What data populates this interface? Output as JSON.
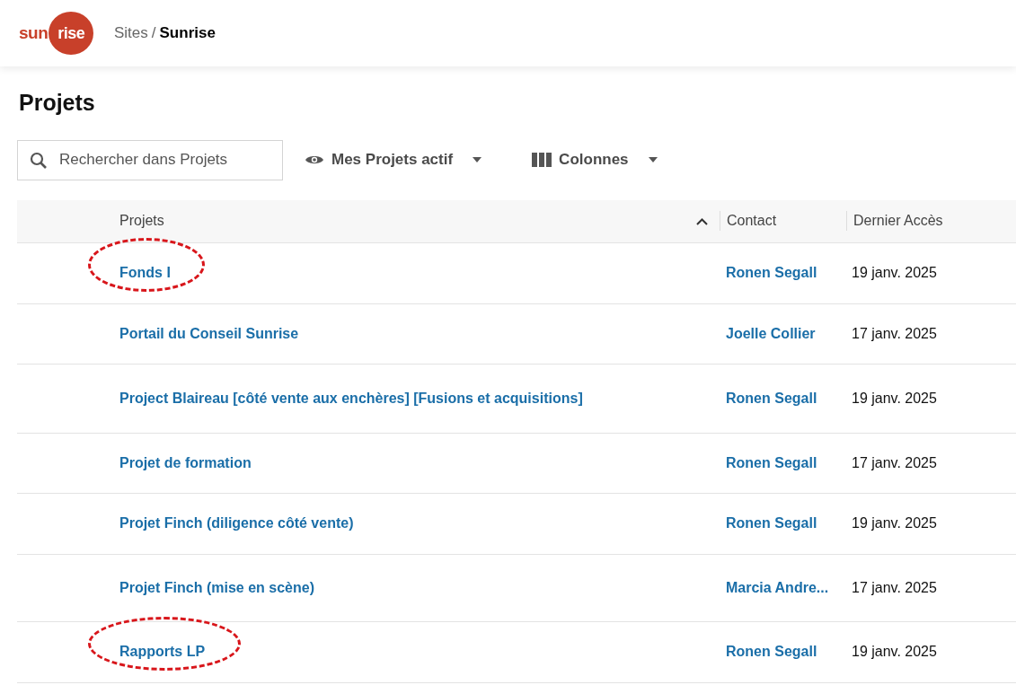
{
  "header": {
    "logo": {
      "part_1": "sun",
      "part_2": "rise"
    },
    "breadcrumb": [
      {
        "label": "Sites",
        "current": false
      },
      {
        "label": "Sunrise",
        "current": true
      }
    ],
    "breadcrumb_separator": "/"
  },
  "page_title": "Projets",
  "toolbar": {
    "search": {
      "placeholder": "Rechercher dans Projets"
    },
    "filter": {
      "label": "Mes Projets actif"
    },
    "columns_menu": {
      "label": "Colonnes"
    }
  },
  "table": {
    "columns": [
      {
        "label": "Projets",
        "sorted": true
      },
      {
        "label": "Contact",
        "sorted": false
      },
      {
        "label": "Dernier Accès",
        "sorted": false
      }
    ],
    "rows": [
      {
        "project": "Fonds I",
        "contact": "Ronen Segall",
        "last_access": "19 janv. 2025",
        "circled": true
      },
      {
        "project": "Portail du Conseil Sunrise",
        "contact": "Joelle Collier",
        "last_access": "17 janv. 2025",
        "circled": false
      },
      {
        "project": "Project Blaireau [côté vente aux enchères] [Fusions et acquisitions]",
        "contact": "Ronen Segall",
        "last_access": "19 janv. 2025",
        "circled": false
      },
      {
        "project": "Projet de formation",
        "contact": "Ronen Segall",
        "last_access": "17 janv. 2025",
        "circled": false
      },
      {
        "project": "Projet Finch (diligence côté vente)",
        "contact": "Ronen Segall",
        "last_access": "19 janv. 2025",
        "circled": false
      },
      {
        "project": "Projet Finch (mise en scène)",
        "contact": "Marcia Andre...",
        "last_access": "17 janv. 2025",
        "circled": false
      },
      {
        "project": "Rapports LP",
        "contact": "Ronen Segall",
        "last_access": "19 janv. 2025",
        "circled": true
      }
    ]
  }
}
